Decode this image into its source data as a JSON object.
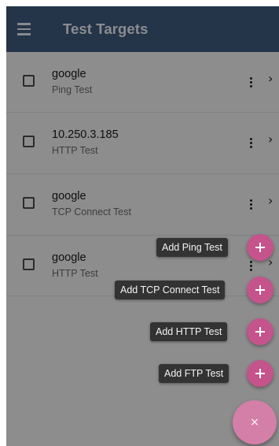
{
  "app_bar": {
    "title": "Test Targets",
    "menu_icon": "menu-icon",
    "color": "#3e5b7e"
  },
  "targets": [
    {
      "name": "google",
      "test_type": "Ping Test"
    },
    {
      "name": "10.250.3.185",
      "test_type": "HTTP Test"
    },
    {
      "name": "google",
      "test_type": "TCP Connect Test"
    },
    {
      "name": "google",
      "test_type": "HTTP Test"
    }
  ],
  "row_icons": {
    "overflow": "more-vert-icon",
    "chevron": "chevron-right-icon",
    "chevron_glyph": "›"
  },
  "speed_dial": {
    "open": true,
    "actions": [
      {
        "label": "Add Ping Test",
        "icon": "plus-icon"
      },
      {
        "label": "Add TCP Connect Test",
        "icon": "plus-icon"
      },
      {
        "label": "Add HTTP Test",
        "icon": "plus-icon"
      },
      {
        "label": "Add FTP Test",
        "icon": "plus-icon"
      }
    ],
    "close_icon": "close-icon",
    "close_glyph": "×",
    "fab_color": "#c4548b"
  }
}
